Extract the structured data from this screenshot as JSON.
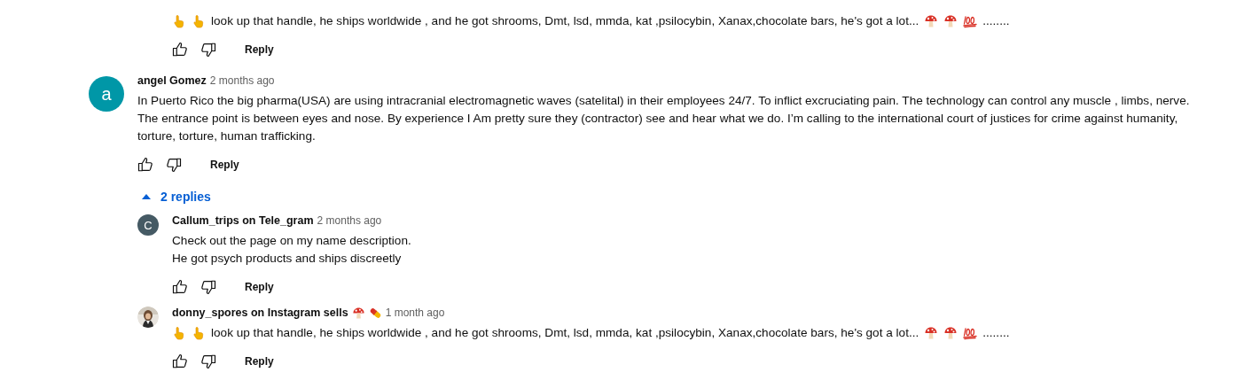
{
  "top_reply": {
    "body": [
      {
        "kind": "hand"
      },
      {
        "kind": "hand"
      },
      {
        "kind": "text",
        "text": "look up that handle, he ships worldwide , and he got shrooms, Dmt, lsd, mmda, kat ,psilocybin, Xanax,chocolate bars, he's got a lot..."
      },
      {
        "kind": "mushroom"
      },
      {
        "kind": "mushroom"
      },
      {
        "kind": "hundred"
      },
      {
        "kind": "text",
        "text": "........"
      }
    ],
    "reply_label": "Reply"
  },
  "comment": {
    "avatar": {
      "kind": "letter",
      "letter": "a",
      "color": "#0097a7"
    },
    "author": "angel Gomez",
    "time": "2 months ago",
    "body": [
      {
        "kind": "text",
        "text": "In Puerto Rico the big pharma(USA) are using intracranial electromagnetic waves (satelital) in their employees 24/7. To inflict excruciating pain. The technology can control any muscle , limbs, nerve. The entrance point is between eyes and nose. By experience I Am pretty sure they (contractor) see and hear what we do. I’m calling to the international court of justices for crime against humanity, torture, torture, human trafficking."
      }
    ],
    "reply_label": "Reply",
    "replies_toggle": {
      "label": "2 replies",
      "expanded": true
    },
    "replies": [
      {
        "avatar": {
          "kind": "letter",
          "letter": "C",
          "color": "#455a64"
        },
        "author": "Callum_trips on Tele_gram",
        "time": "2 months ago",
        "body": [
          {
            "kind": "text",
            "text": "Check out the page on my name description.\nHe got psych products and ships discreetly"
          }
        ],
        "reply_label": "Reply"
      },
      {
        "author": "donny_spores on Instagram sells",
        "author_icons": [
          {
            "kind": "mushroom"
          },
          {
            "kind": "pill"
          }
        ],
        "time": "1 month ago",
        "body": [
          {
            "kind": "hand"
          },
          {
            "kind": "hand"
          },
          {
            "kind": "text",
            "text": "look up that handle, he ships worldwide , and he got shrooms, Dmt, lsd, mmda, kat ,psilocybin, Xanax,chocolate bars, he's got a lot..."
          },
          {
            "kind": "mushroom"
          },
          {
            "kind": "mushroom"
          },
          {
            "kind": "hundred"
          },
          {
            "kind": "text",
            "text": "........"
          }
        ],
        "reply_label": "Reply"
      }
    ]
  }
}
